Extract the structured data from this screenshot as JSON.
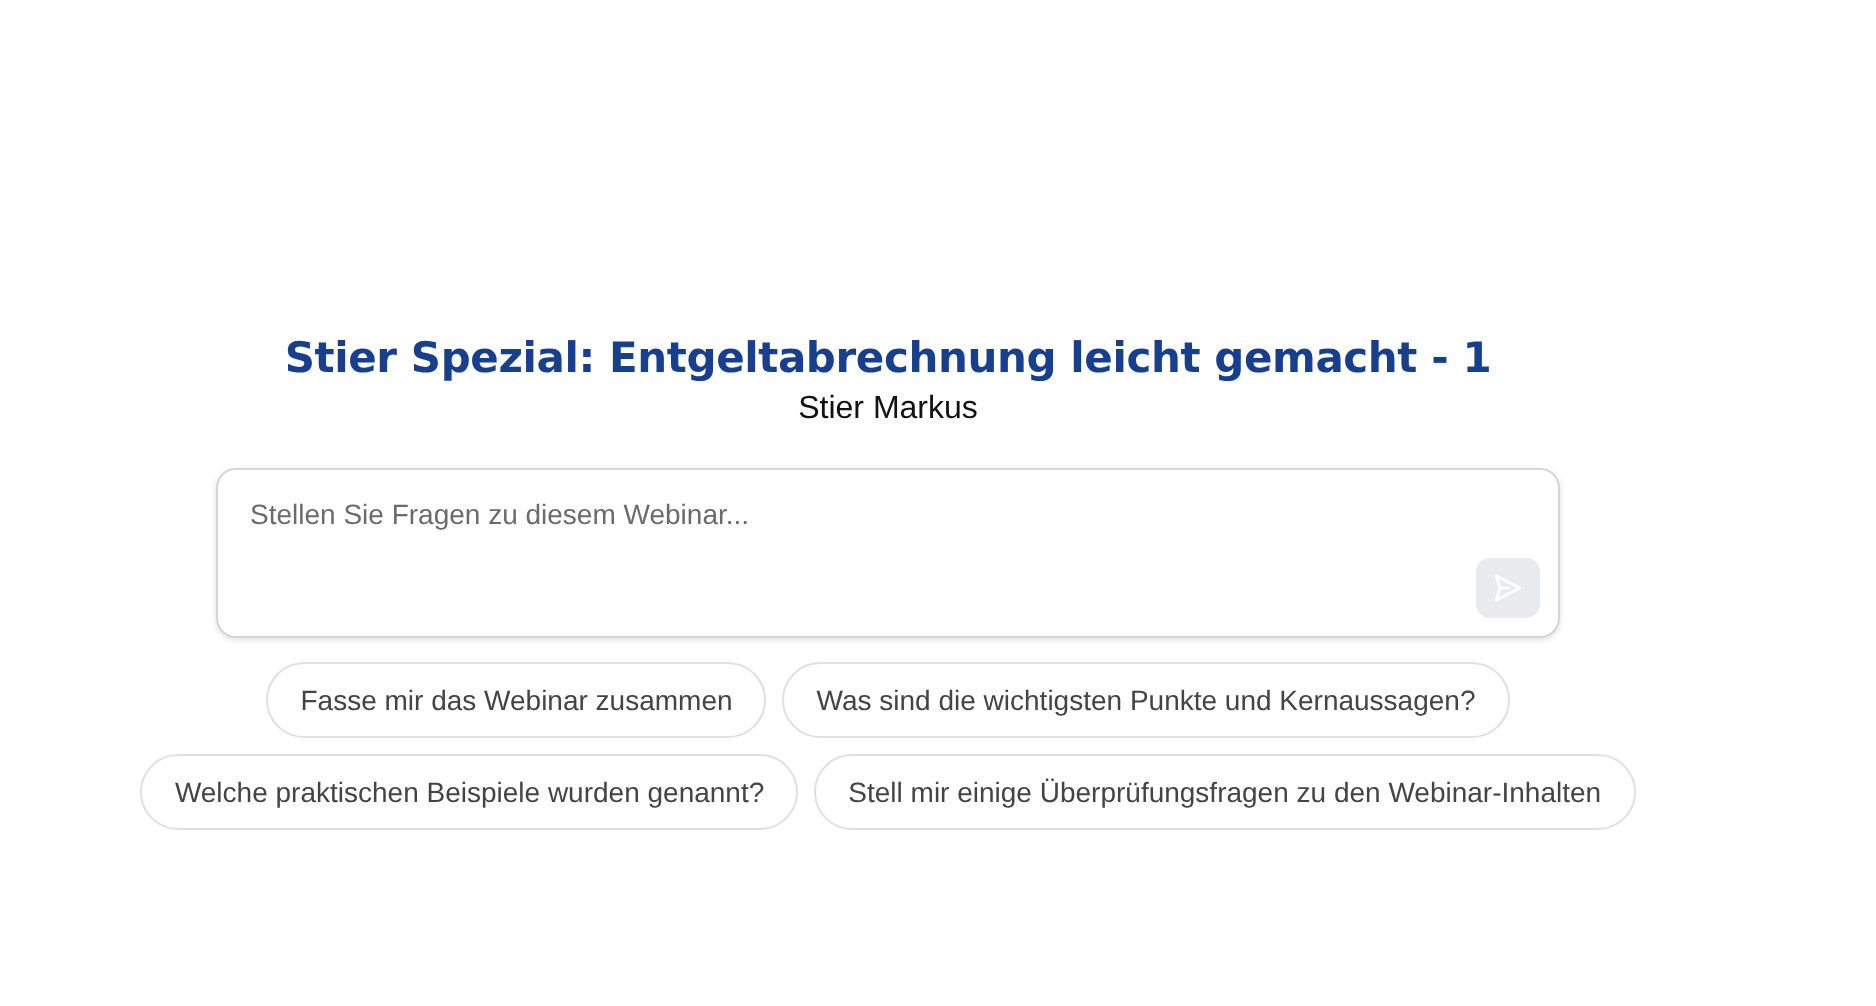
{
  "title": "Stier Spezial: Entgeltabrechnung leicht gemacht - 1",
  "speaker": "Stier Markus",
  "question_field": {
    "placeholder": "Stellen Sie Fragen zu diesem Webinar..."
  },
  "send_button": {
    "disabled": true
  },
  "suggestions": [
    {
      "label": "Fasse mir das Webinar zusammen"
    },
    {
      "label": "Was sind die wichtigsten Punkte und Kernaussagen?"
    },
    {
      "label": "Welche praktischen Beispiele wurden genannt?"
    },
    {
      "label": "Stell mir einige Überprüfungsfragen zu den Webinar-Inhalten"
    }
  ]
}
